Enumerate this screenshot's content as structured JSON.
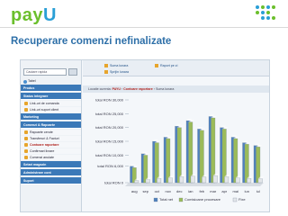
{
  "header": {
    "logo_p": "pay",
    "logo_u": "U"
  },
  "slide_title": "Recuperare comenzi nefinalizate",
  "screenshot": {
    "search_placeholder": "Cautare rapida",
    "quick_links": [
      "Suma lunara",
      "Raport pe zi",
      "Sprijin lunara"
    ],
    "breadcrumb": {
      "prefix": "Locatie curenta:",
      "path": [
        "PAYU",
        "Contoare raportare",
        "Suma lunara"
      ]
    },
    "nav": [
      {
        "type": "dash",
        "label": "Tabel"
      },
      {
        "type": "head",
        "label": "Produs"
      },
      {
        "type": "head",
        "label": "Status integrare"
      },
      {
        "type": "sub",
        "label": "Link-uri de comanda"
      },
      {
        "type": "sub",
        "label": "Link-uri suport client"
      },
      {
        "type": "head",
        "label": "Marketing"
      },
      {
        "type": "head",
        "label": "Comenzi & Rapoarte"
      },
      {
        "type": "sub",
        "label": "Rapoarte cerute"
      },
      {
        "type": "sub",
        "label": "Transferuri & Facturi"
      },
      {
        "type": "sub",
        "label": "Contoare raportare",
        "active": true
      },
      {
        "type": "sub",
        "label": "Confirmari livrare"
      },
      {
        "type": "sub",
        "label": "Comenzi anulate"
      },
      {
        "type": "head",
        "label": "Setari magazin"
      },
      {
        "type": "head",
        "label": "Administrare cont"
      },
      {
        "type": "head",
        "label": "Suport"
      }
    ]
  },
  "chart_data": {
    "type": "bar",
    "categories": [
      "aug",
      "sep",
      "oct",
      "nov",
      "dec",
      "ian",
      "feb",
      "mar",
      "apr",
      "mai",
      "iun",
      "iul"
    ],
    "series": [
      {
        "name": "Total net",
        "values": [
          6000,
          10500,
          15000,
          16500,
          20500,
          22500,
          19500,
          24000,
          20000,
          16500,
          14500,
          13500
        ],
        "color": "#4f81bd"
      },
      {
        "name": "Comisioane procesare",
        "values": [
          5500,
          10000,
          14500,
          16000,
          20000,
          22000,
          19000,
          23500,
          19500,
          16000,
          14000,
          13000
        ],
        "color": "#9bbb59"
      },
      {
        "name": "Fixe",
        "values": [
          800,
          1200,
          1600,
          1800,
          2200,
          2400,
          2100,
          2600,
          2200,
          1800,
          1600,
          1500
        ],
        "color": "#e3e6ea"
      }
    ],
    "ylabels": [
      "total RON 30,000",
      "total RON 25,000",
      "total RON 20,000",
      "total RON 15,000",
      "total RON 10,000",
      "total RON 6,000",
      "total RON 0"
    ],
    "yticks": [
      30000,
      25000,
      20000,
      15000,
      10000,
      6000,
      0
    ],
    "ylim": [
      0,
      30000
    ]
  }
}
